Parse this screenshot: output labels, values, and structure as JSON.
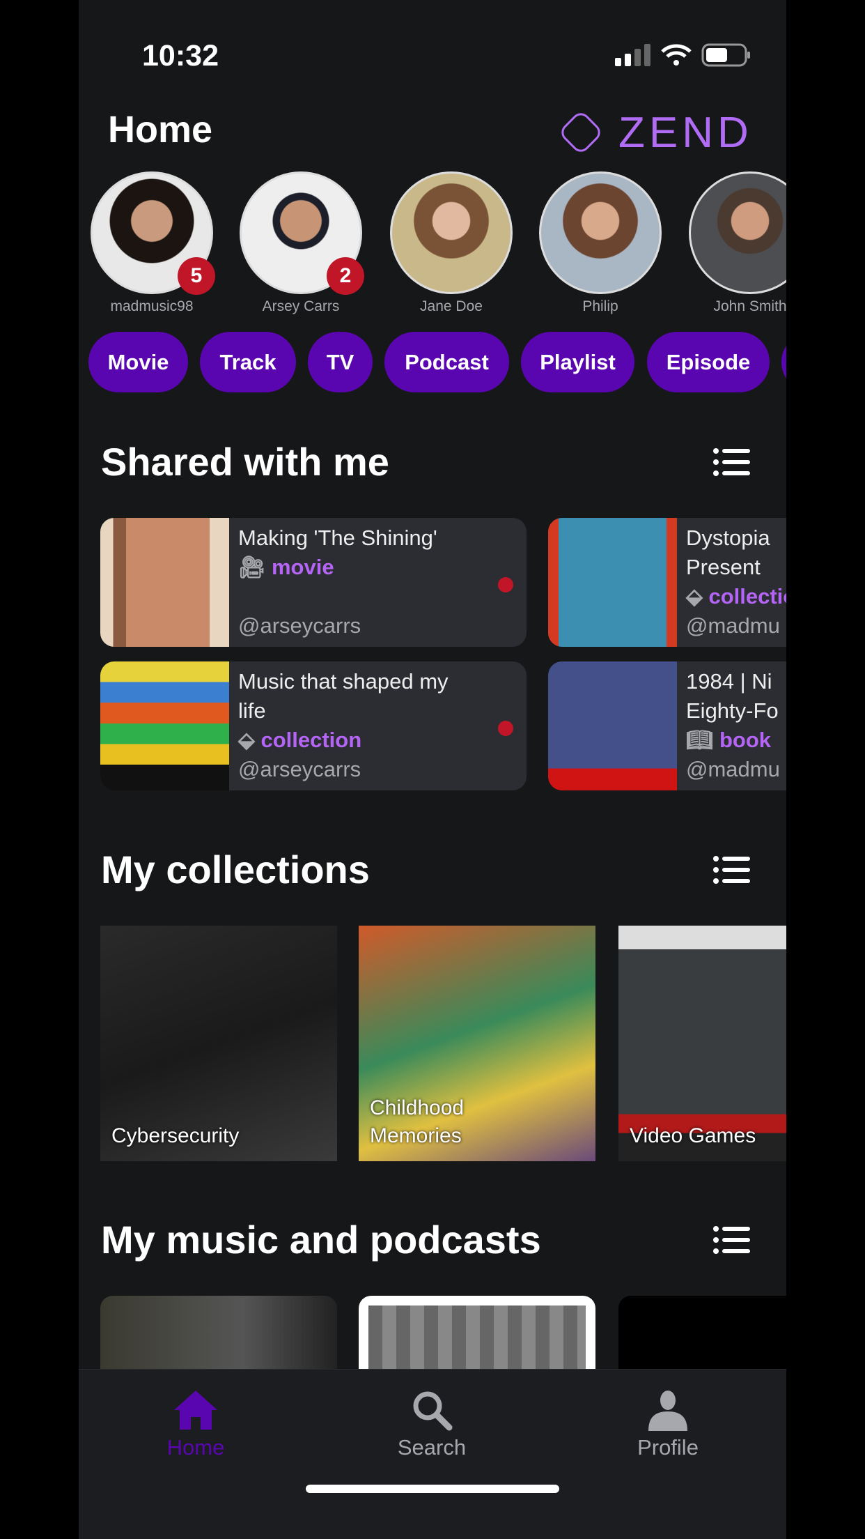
{
  "status_bar": {
    "time": "10:32"
  },
  "header": {
    "title": "Home",
    "logo_text": "ZEND"
  },
  "friends": [
    {
      "name": "madmusic98",
      "badge": "5"
    },
    {
      "name": "Arsey Carrs",
      "badge": "2"
    },
    {
      "name": "Jane Doe"
    },
    {
      "name": "Philip"
    },
    {
      "name": "John Smith"
    }
  ],
  "filters": [
    "Movie",
    "Track",
    "TV",
    "Podcast",
    "Playlist",
    "Episode"
  ],
  "shared": {
    "title": "Shared with me",
    "items": [
      {
        "title": "Making 'The Shining'",
        "type": "movie",
        "icon": "film-camera-icon",
        "user": "@arseycarrs",
        "unread": true
      },
      {
        "title": "Dystopia Present",
        "type": "collection",
        "icon": "layers-icon",
        "user": "@madmu"
      },
      {
        "title": "Music that shaped my life",
        "type": "collection",
        "icon": "layers-icon",
        "user": "@arseycarrs",
        "unread": true
      },
      {
        "title": "1984 | Ni Eighty-Fo",
        "type": "book",
        "icon": "book-reader-icon",
        "user": "@madmu"
      }
    ]
  },
  "collections": {
    "title": "My collections",
    "items": [
      {
        "label": "Cybersecurity"
      },
      {
        "label": "Childhood Memories"
      },
      {
        "label": "Video Games"
      }
    ]
  },
  "music": {
    "title": "My music and podcasts"
  },
  "tabbar": {
    "items": [
      {
        "label": "Home",
        "active": true
      },
      {
        "label": "Search"
      },
      {
        "label": "Profile"
      }
    ]
  },
  "colors": {
    "accent": "#5a06b0",
    "type_text": "#b565f5",
    "badge": "#c01628",
    "background": "#161719",
    "card": "#2c2d33"
  }
}
